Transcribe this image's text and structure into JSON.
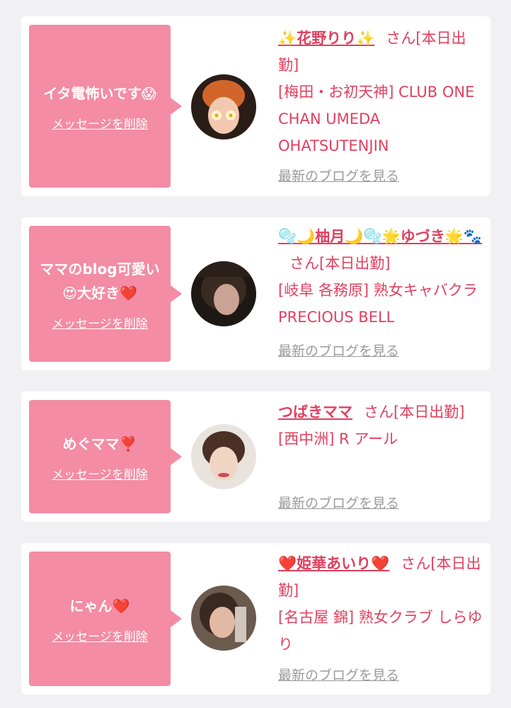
{
  "colors": {
    "bubble": "#f38ca4",
    "accent": "#e0405f",
    "link_gray": "#9a9a9a",
    "background": "#f1f1f3"
  },
  "cards": [
    {
      "message": "イタ電怖いです😱",
      "delete_label": "メッセージを削除",
      "name": "✨花野りり✨",
      "suffix": "さん[本日出勤]",
      "shop": "[梅田・お初天神] CLUB ONE CHAN UMEDA OHATSUTENJIN",
      "blog_label": "最新のブログを見る"
    },
    {
      "message": "ママのblog可愛い😍大好き❤️",
      "delete_label": "メッセージを削除",
      "name": "🫧🌙柚月🌙🫧🌟ゆづき🌟🐾",
      "suffix": "さん[本日出勤]",
      "shop": "[岐阜 各務原] 熟女キャバクラ PRECIOUS BELL",
      "blog_label": "最新のブログを見る"
    },
    {
      "message": "めぐママ❣️",
      "delete_label": "メッセージを削除",
      "name": "つばきママ",
      "suffix": "さん[本日出勤]",
      "shop": "[西中洲] R アール",
      "blog_label": "最新のブログを見る"
    },
    {
      "message": "にゃん❤️",
      "delete_label": "メッセージを削除",
      "name": "❤️姫華あいり❤️",
      "suffix": "さん[本日出勤]",
      "shop": "[名古屋 錦] 熟女クラブ しらゆり",
      "blog_label": "最新のブログを見る"
    }
  ]
}
